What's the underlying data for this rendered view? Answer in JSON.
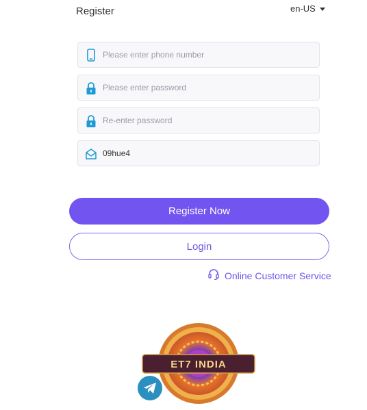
{
  "header": {
    "title": "Register",
    "language": "en-US"
  },
  "form": {
    "phone_placeholder": "Please enter phone number",
    "password_placeholder": "Please enter password",
    "reenter_placeholder": "Re-enter password",
    "invite_code_value": "09hue4"
  },
  "actions": {
    "register_label": "Register Now",
    "login_label": "Login",
    "service_label": "Online Customer Service"
  },
  "brand": {
    "logo_text": "ET7 INDIA"
  },
  "colors": {
    "accent": "#7255f0",
    "icon": "#1e9ad6",
    "outline": "#7a68e8"
  }
}
